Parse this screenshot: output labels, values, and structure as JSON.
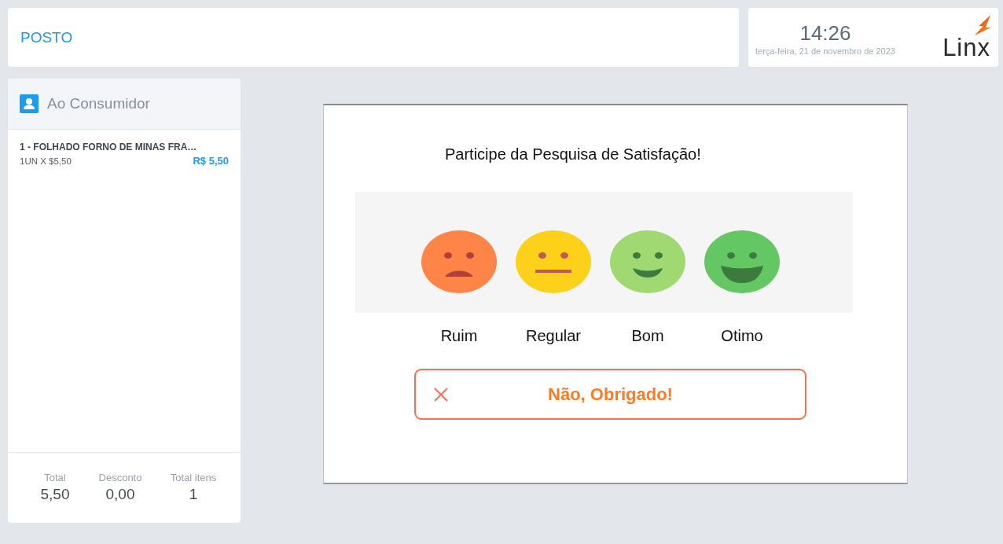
{
  "header": {
    "title": "POSTO"
  },
  "clock": {
    "time": "14:26",
    "date": "terça-feira, 21 de novembro de 2023"
  },
  "logo": {
    "text": "Linx"
  },
  "customer_panel": {
    "customer": "Ao Consumidor",
    "items": [
      {
        "title": "1 - FOLHADO FORNO DE MINAS FRA…",
        "quantity": "1UN X $5,50",
        "price": "R$ 5,50"
      }
    ],
    "totals": [
      {
        "label": "Total",
        "value": "5,50"
      },
      {
        "label": "Desconto",
        "value": "0,00"
      },
      {
        "label": "Total itens",
        "value": "1"
      }
    ]
  },
  "survey_dialog": {
    "title": "Participe da Pesquisa de Satisfação!",
    "options": [
      {
        "kind": "sad",
        "label": "Ruim",
        "color": "#ff8447"
      },
      {
        "kind": "neutral",
        "label": "Regular",
        "color": "#fdd01a"
      },
      {
        "kind": "smile",
        "label": "Bom",
        "color": "#a0d872"
      },
      {
        "kind": "grin",
        "label": "Otimo",
        "color": "#63c763"
      }
    ],
    "dismiss_button": "Não, Obrigado!"
  }
}
